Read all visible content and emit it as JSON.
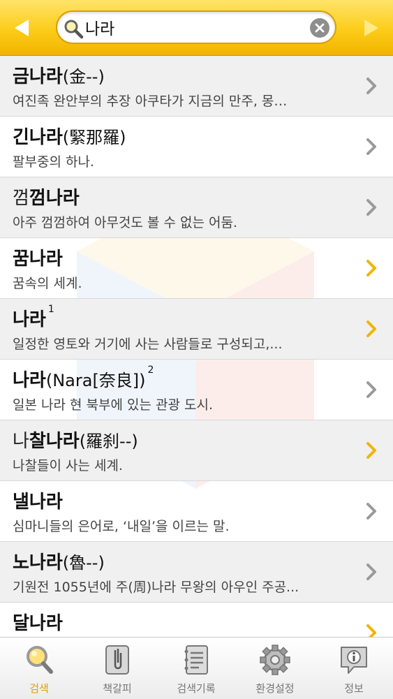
{
  "header": {
    "search_value": "나라",
    "back_icon": "back-arrow-icon",
    "forward_icon": "forward-arrow-icon"
  },
  "results": [
    {
      "pre": "",
      "bold": "금나라",
      "post": "(金--)",
      "sup": "",
      "desc": "여진족 완안부의 추장 아쿠타가 지금의 만주, 몽…",
      "chevron": "gray"
    },
    {
      "pre": "",
      "bold": "긴나라",
      "post": "(緊那羅)",
      "sup": "",
      "desc": "팔부중의 하나.",
      "chevron": "gray"
    },
    {
      "pre": "껌",
      "bold": "껌나라",
      "post": "",
      "sup": "",
      "desc": "아주 껌껌하여 아무것도 볼 수 없는 어둠.",
      "chevron": "gray"
    },
    {
      "pre": "",
      "bold": "꿈나라",
      "post": "",
      "sup": "",
      "desc": "꿈속의 세계.",
      "chevron": "yellow"
    },
    {
      "pre": "",
      "bold": "나라",
      "post": "",
      "sup": "1",
      "desc": "일정한 영토와 거기에 사는 사람들로 구성되고,...",
      "chevron": "yellow"
    },
    {
      "pre": "",
      "bold": "나라",
      "post": "(Nara[奈良])",
      "sup": "2",
      "desc": "일본 나라 현 북부에 있는 관광 도시.",
      "chevron": "gray"
    },
    {
      "pre": "나",
      "bold": "찰나라",
      "post": "(羅刹--)",
      "sup": "",
      "desc": "나찰들이 사는 세계.",
      "chevron": "yellow"
    },
    {
      "pre": "",
      "bold": "낼나라",
      "post": "",
      "sup": "",
      "desc": "심마니들의 은어로, ‘내일’을 이르는 말.",
      "chevron": "gray"
    },
    {
      "pre": "",
      "bold": "노나라",
      "post": "(魯--)",
      "sup": "",
      "desc": "기원전 1055년에 주(周)나라 무왕의 아우인 주공...",
      "chevron": "gray"
    },
    {
      "pre": "",
      "bold": "달나라",
      "post": "",
      "sup": "",
      "desc": "",
      "chevron": "yellow"
    }
  ],
  "tabs": [
    {
      "label": "검색",
      "icon": "search-icon",
      "active": true
    },
    {
      "label": "책갈피",
      "icon": "bookmark-icon",
      "active": false
    },
    {
      "label": "검색기록",
      "icon": "history-icon",
      "active": false
    },
    {
      "label": "환경설정",
      "icon": "gear-icon",
      "active": false
    },
    {
      "label": "정보",
      "icon": "info-icon",
      "active": false
    }
  ],
  "colors": {
    "header_yellow": "#fccc18",
    "chevron_yellow": "#f2b400",
    "chevron_gray": "#9a9a9a",
    "tab_active": "#e0a100"
  }
}
